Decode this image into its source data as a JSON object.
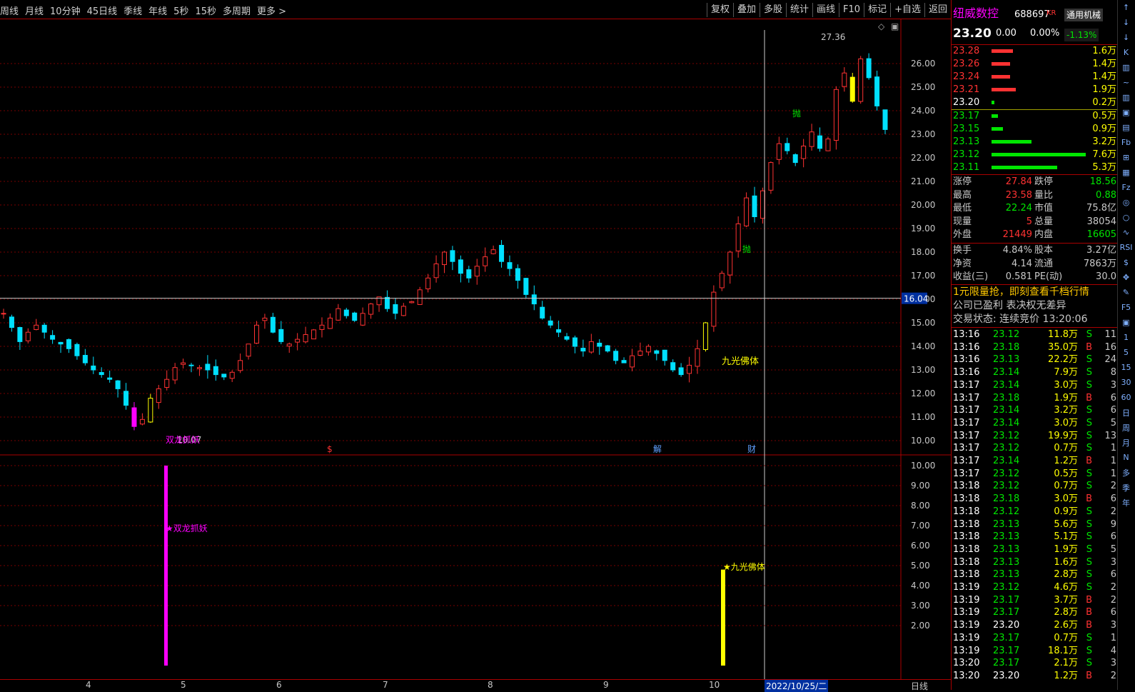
{
  "nav": {
    "left": [
      "周线",
      "月线",
      "10分钟",
      "45日线",
      "季线",
      "年线",
      "5秒",
      "15秒",
      "多周期",
      "更多 >"
    ],
    "right": [
      "复权",
      "叠加",
      "多股",
      "统计",
      "画线",
      "F10",
      "标记",
      "+自选",
      "返回"
    ]
  },
  "stock": {
    "name": "纽威数控",
    "code": "688697",
    "suffix": "KR",
    "sector": "通用机械",
    "price": "23.20",
    "change": "0.00",
    "pct": "0.00%",
    "sector_pct": "-1.13%"
  },
  "asks": [
    [
      "23.28",
      "1.6万",
      30
    ],
    [
      "23.26",
      "1.4万",
      26
    ],
    [
      "23.24",
      "1.4万",
      26
    ],
    [
      "23.21",
      "1.9万",
      34
    ],
    [
      "23.20",
      "0.2万",
      4
    ]
  ],
  "bids": [
    [
      "23.17",
      "0.5万",
      9
    ],
    [
      "23.15",
      "0.9万",
      16
    ],
    [
      "23.13",
      "3.2万",
      56
    ],
    [
      "23.12",
      "7.6万",
      132
    ],
    [
      "23.11",
      "5.3万",
      92
    ]
  ],
  "stats": [
    [
      "涨停",
      "27.84",
      "red",
      "跌停",
      "18.56",
      "grn"
    ],
    [
      "最高",
      "23.58",
      "red",
      "量比",
      "0.88",
      "grn"
    ],
    [
      "最低",
      "22.24",
      "grn",
      "市值",
      "75.8亿",
      "gry"
    ],
    [
      "现量",
      "5",
      "red",
      "总量",
      "38054",
      "gry"
    ],
    [
      "外盘",
      "21449",
      "red",
      "内盘",
      "16605",
      "grn"
    ]
  ],
  "stats2": [
    [
      "换手",
      "4.84%",
      "股本",
      "3.27亿"
    ],
    [
      "净资",
      "4.14",
      "流通",
      "7863万"
    ],
    [
      "收益(三)",
      "0.581",
      "PE(动)",
      "30.0"
    ]
  ],
  "ad": "1元限量抢，即刻查看千档行情",
  "notes": [
    "公司已盈利 表决权无差异",
    "交易状态: 连续竞价 13:20:06"
  ],
  "ticks": [
    [
      "13:16",
      "23.12",
      "11.8万",
      "S",
      "11"
    ],
    [
      "13:16",
      "23.18",
      "35.0万",
      "B",
      "16"
    ],
    [
      "13:16",
      "23.13",
      "22.2万",
      "S",
      "24"
    ],
    [
      "13:16",
      "23.14",
      "7.9万",
      "S",
      "8"
    ],
    [
      "13:17",
      "23.14",
      "3.0万",
      "S",
      "3"
    ],
    [
      "13:17",
      "23.18",
      "1.9万",
      "B",
      "6"
    ],
    [
      "13:17",
      "23.14",
      "3.2万",
      "S",
      "6"
    ],
    [
      "13:17",
      "23.14",
      "3.0万",
      "S",
      "5"
    ],
    [
      "13:17",
      "23.12",
      "19.9万",
      "S",
      "13"
    ],
    [
      "13:17",
      "23.12",
      "0.7万",
      "S",
      "1"
    ],
    [
      "13:17",
      "23.14",
      "1.2万",
      "B",
      "1"
    ],
    [
      "13:17",
      "23.12",
      "0.5万",
      "S",
      "1"
    ],
    [
      "13:18",
      "23.12",
      "0.7万",
      "S",
      "2"
    ],
    [
      "13:18",
      "23.18",
      "3.0万",
      "B",
      "6"
    ],
    [
      "13:18",
      "23.12",
      "0.9万",
      "S",
      "2"
    ],
    [
      "13:18",
      "23.13",
      "5.6万",
      "S",
      "9"
    ],
    [
      "13:18",
      "23.13",
      "5.1万",
      "S",
      "6"
    ],
    [
      "13:18",
      "23.13",
      "1.9万",
      "S",
      "5"
    ],
    [
      "13:18",
      "23.13",
      "1.6万",
      "S",
      "3"
    ],
    [
      "13:18",
      "23.13",
      "2.8万",
      "S",
      "6"
    ],
    [
      "13:19",
      "23.12",
      "4.6万",
      "S",
      "2"
    ],
    [
      "13:19",
      "23.17",
      "3.7万",
      "B",
      "2"
    ],
    [
      "13:19",
      "23.17",
      "2.8万",
      "B",
      "6"
    ],
    [
      "13:19",
      "23.20",
      "2.6万",
      "B",
      "3"
    ],
    [
      "13:19",
      "23.17",
      "0.7万",
      "S",
      "1"
    ],
    [
      "13:19",
      "23.17",
      "18.1万",
      "S",
      "4"
    ],
    [
      "13:20",
      "23.17",
      "2.1万",
      "S",
      "3"
    ],
    [
      "13:20",
      "23.20",
      "1.2万",
      "B",
      "2"
    ]
  ],
  "chart": {
    "yticks": [
      "26.00",
      "25.00",
      "24.00",
      "23.00",
      "22.00",
      "21.00",
      "20.00",
      "19.00",
      "18.00",
      "17.00",
      "16.00",
      "15.00",
      "14.00",
      "13.00",
      "12.00",
      "11.00",
      "10.00"
    ],
    "crosshair_price": "16.04",
    "high_label": "27.36",
    "low_label": "10.07",
    "ind_yticks": [
      "10.00",
      "9.00",
      "8.00",
      "7.00",
      "6.00",
      "5.00",
      "4.00",
      "3.00",
      "2.00"
    ],
    "xticks": [
      "4",
      "5",
      "6",
      "7",
      "8",
      "9",
      "10"
    ],
    "date_label": "2022/10/25/二",
    "period": "日线",
    "signals": {
      "dragon": "双龙抓妖",
      "jiuguang": "九光佛体",
      "pao": "抛"
    },
    "markers": [
      "$",
      "解",
      "财"
    ],
    "ind_signal1": "★双龙抓妖",
    "ind_signal2": "★九光佛体"
  },
  "chart_data": {
    "type": "candlestick",
    "ylim": [
      10,
      27.36
    ],
    "low": 10.07,
    "high": 27.36,
    "crosshair": 16.04,
    "indicator": {
      "ylim": [
        0,
        10
      ],
      "bars": [
        {
          "label": "★双龙抓妖",
          "value": 10
        },
        {
          "label": "★九光佛体",
          "value": 4.8
        }
      ]
    }
  },
  "toolbar": [
    "↑",
    "↓",
    "↓",
    "K",
    "▥",
    "~",
    "▥",
    "▣",
    "▤",
    "Fb",
    "⊞",
    "▦",
    "Fz",
    "◎",
    "○",
    "∿",
    "RSI",
    "$",
    "✥",
    "✎",
    "F5",
    "▣",
    "1",
    "5",
    "15",
    "30",
    "60",
    "日",
    "周",
    "月",
    "N",
    "多",
    "季",
    "年"
  ]
}
